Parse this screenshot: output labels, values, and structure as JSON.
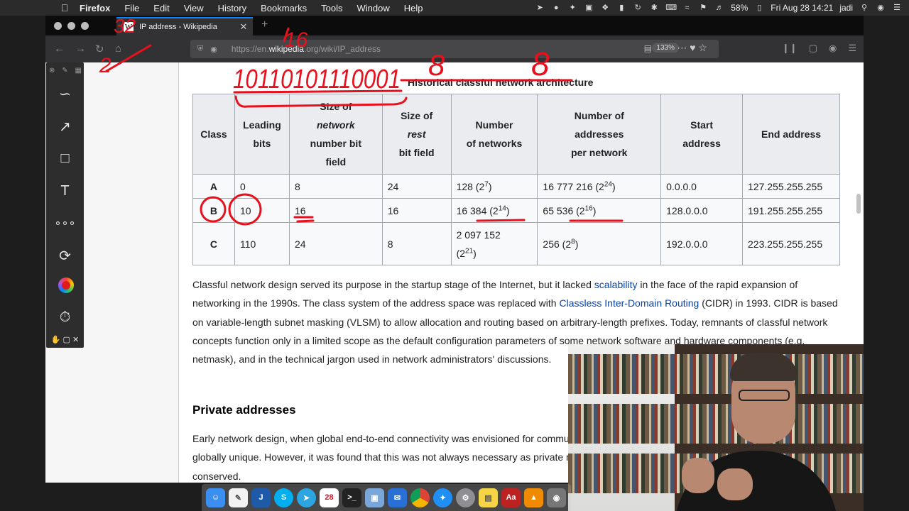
{
  "menubar": {
    "apple": "",
    "app_name": "Firefox",
    "items": [
      "File",
      "Edit",
      "View",
      "History",
      "Bookmarks",
      "Tools",
      "Window",
      "Help"
    ],
    "battery": "58%",
    "datetime": "Fri Aug 28  14:21",
    "user": "jadi"
  },
  "browser": {
    "tab_title": "IP address - Wikipedia",
    "tab_favicon": "W",
    "url_protocol": "https://en.",
    "url_host": "wikipedia",
    "url_rest": ".org/wiki/IP_address",
    "zoom": "133%"
  },
  "table": {
    "caption": "Historical classful network architecture",
    "headers": [
      {
        "lines": [
          "Class"
        ]
      },
      {
        "lines": [
          "Leading",
          "bits"
        ]
      },
      {
        "lines": [
          "Size of",
          "network",
          "number bit",
          "field"
        ],
        "italic": [
          1
        ],
        "italic_word": "network"
      },
      {
        "lines": [
          "Size of",
          "rest",
          "bit field"
        ],
        "italic": [
          1
        ]
      },
      {
        "lines": [
          "Number",
          "of networks"
        ]
      },
      {
        "lines": [
          "Number of",
          "addresses",
          "per network"
        ]
      },
      {
        "lines": [
          "Start",
          "address"
        ]
      },
      {
        "lines": [
          "End address"
        ]
      }
    ],
    "rows": [
      {
        "cls": "A",
        "lead": "0",
        "net": "8",
        "rest": "24",
        "nets": "128 (2",
        "nets_exp": "7",
        "nets_close": ")",
        "nets_br": false,
        "addrs": "16 777 216 (2",
        "addrs_exp": "24",
        "addrs_close": ")",
        "start": "0.0.0.0",
        "end": "127.255.255.255"
      },
      {
        "cls": "B",
        "lead": "10",
        "net": "16",
        "rest": "16",
        "nets": "16 384 (2",
        "nets_exp": "14",
        "nets_close": ")",
        "nets_br": false,
        "addrs": "65 536 (2",
        "addrs_exp": "16",
        "addrs_close": ")",
        "start": "128.0.0.0",
        "end": "191.255.255.255"
      },
      {
        "cls": "C",
        "lead": "110",
        "net": "24",
        "rest": "8",
        "nets": "2 097 152",
        "nets_br": true,
        "nets_paren": "(2",
        "nets_exp": "21",
        "nets_close": ")",
        "addrs": "256 (2",
        "addrs_exp": "8",
        "addrs_close": ")",
        "start": "192.0.0.0",
        "end": "223.255.255.255"
      }
    ]
  },
  "para1": {
    "t1": "Classful network design served its purpose in the startup stage of the Internet, but it lacked ",
    "link1": "scalability",
    "t2": " in the face of the rapid expansion of networking in the 1990s. The class system of the address space was replaced with ",
    "link2": "Classless Inter-Domain Routing",
    "t3": " (CIDR) in 1993. CIDR is based on variable-length subnet masking (VLSM) to allow allocation and routing based on arbitrary-length prefixes. Today, remnants of classful network concepts function only in a limited scope as the default configuration parameters of some network software and hardware components (e.g. netmask), and in the technical jargon used in network administrators' discussions."
  },
  "heading_private": "Private addresses",
  "para2": "Early network design, when global end-to-end connectivity was envisioned for communications with all Internet hosts, intended that IP addresses be globally unique. However, it was found that this was not always necessary as private networks developed and public address space needed to be conserved.",
  "ink": {
    "color": "#e8101c",
    "binary": "10110101110001",
    "num_32": "32",
    "num_2": "2",
    "num_16": "16",
    "num_8a": "8",
    "num_8b": "8"
  },
  "palette": {
    "icons": [
      "pen-icon",
      "arrow-icon",
      "rectangle-icon",
      "text-icon",
      "link-icon",
      "undo-icon",
      "color-wheel-icon",
      "timer-icon"
    ]
  },
  "dock": {
    "apps": [
      "finder",
      "textedit",
      "jetbrains",
      "skype",
      "telegram",
      "calendar",
      "terminal",
      "preview",
      "thunderbird",
      "chrome",
      "safari",
      "system-preferences",
      "stickies",
      "dictionary",
      "vlc",
      "keynote"
    ],
    "calendar_day": "28"
  }
}
